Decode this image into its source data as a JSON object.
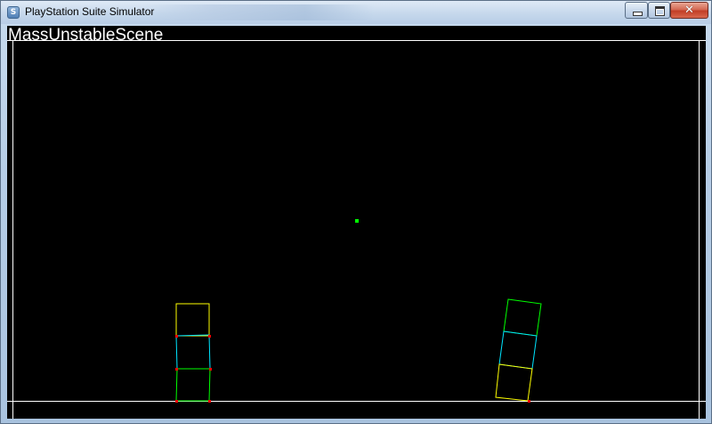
{
  "window": {
    "title": "PlayStation Suite Simulator",
    "icon": "app-icon",
    "controls": {
      "minimize": "minimize-icon",
      "maximize": "maximize-icon",
      "close_glyph": "✕"
    }
  },
  "scene": {
    "name": "MassUnstableScene",
    "background": "#000000",
    "colors": {
      "frame": "#ffffff",
      "box_yellow": "#ffff00",
      "box_cyan": "#00e5ff",
      "box_green": "#00ff00",
      "contact_point": "#ff0000",
      "center_marker": "#00ff00"
    }
  }
}
